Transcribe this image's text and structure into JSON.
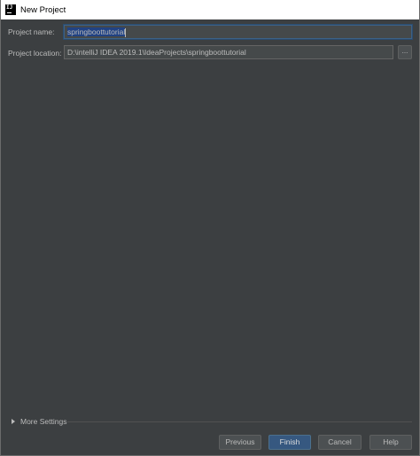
{
  "window": {
    "title": "New Project",
    "icon": "intellij-idea-icon",
    "icon_text": "IJ"
  },
  "form": {
    "project_name_label": "Project name:",
    "project_name_value": "springboottutorial",
    "project_location_label": "Project location:",
    "project_location_value": "D:\\intelliJ IDEA 2019.1\\IdeaProjects\\springboottutorial",
    "browse_label": "..."
  },
  "more_settings": {
    "label": "More Settings",
    "expanded": false
  },
  "buttons": {
    "previous": "Previous",
    "finish": "Finish",
    "cancel": "Cancel",
    "help": "Help"
  },
  "colors": {
    "background": "#3c3f41",
    "accent": "#365880",
    "focus_border": "#3d6185",
    "text": "#bbbbbb"
  }
}
